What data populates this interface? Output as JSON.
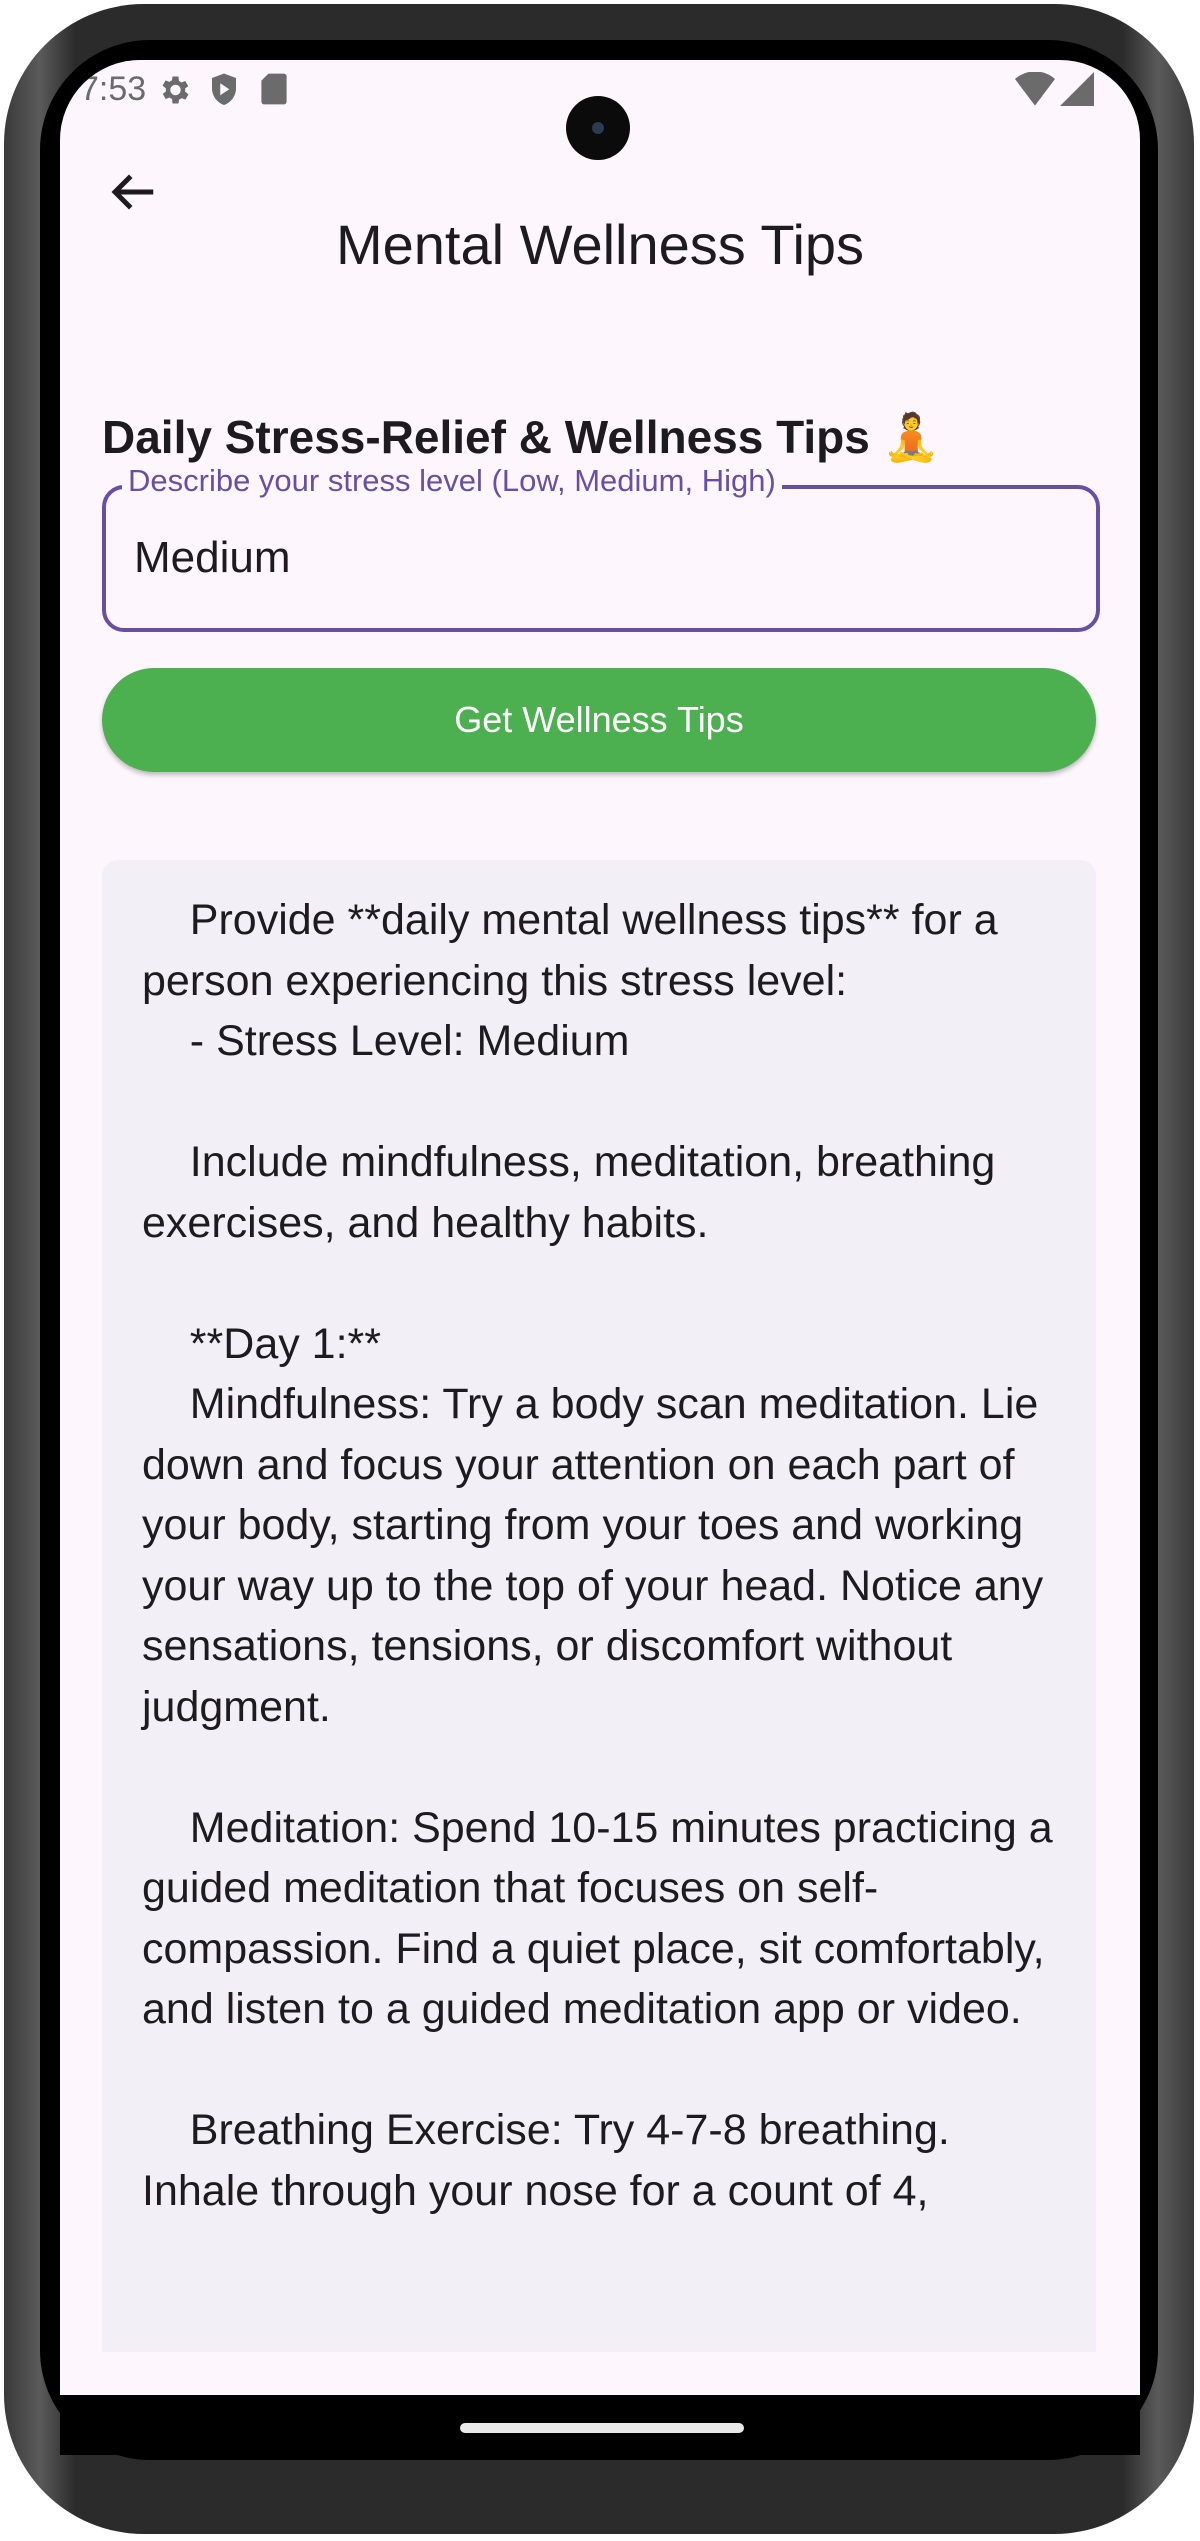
{
  "status_bar": {
    "time": "7:53",
    "icons": [
      "gear-icon",
      "shield-play-icon",
      "sd-card-icon",
      "wifi-icon",
      "cell-signal-icon"
    ]
  },
  "app_bar": {
    "title": "Mental Wellness Tips",
    "back_icon": "arrow-left-icon"
  },
  "main": {
    "heading": "Daily Stress-Relief & Wellness Tips 🧘",
    "stress_field": {
      "label": "Describe your stress level (Low, Medium, High)",
      "value": "Medium"
    },
    "submit_button": "Get Wellness Tips",
    "result_text": "    Provide **daily mental wellness tips** for a person experiencing this stress level:\n    - Stress Level: Medium\n\n    Include mindfulness, meditation, breathing exercises, and healthy habits.\n\n    **Day 1:**\n    Mindfulness: Try a body scan meditation. Lie down and focus your attention on each part of your body, starting from your toes and working your way up to the top of your head. Notice any sensations, tensions, or discomfort without judgment.\n\n    Meditation: Spend 10-15 minutes practicing a guided meditation that focuses on self-compassion. Find a quiet place, sit comfortably, and listen to a guided meditation app or video.\n\n    Breathing Exercise: Try 4-7-8 breathing. Inhale through your nose for a count of 4,"
  },
  "colors": {
    "primary": "#6750a4",
    "button": "#4caf50",
    "background": "#fdf7fd",
    "card": "#f3eff6"
  }
}
